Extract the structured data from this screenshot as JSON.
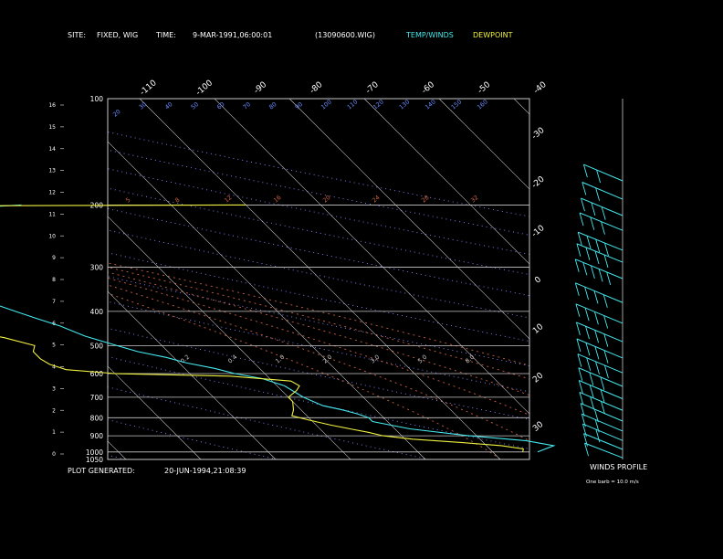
{
  "header": {
    "site_label": "SITE:",
    "site_value": "FIXED, WIG",
    "time_label": "TIME:",
    "time_value": "9-MAR-1991,06:00:01",
    "file_id": "(13090600.WIG)",
    "legend_temp": "TEMP/WINDS",
    "legend_dew": "DEWPOINT"
  },
  "footer": {
    "generated_label": "PLOT GENERATED:",
    "generated_value": "20-JUN-1994,21:08:39"
  },
  "winds_panel": {
    "title": "WINDS PROFILE",
    "note": "One barb = 10.0 m/s"
  },
  "colors": {
    "background": "#000000",
    "frame": "#c8c8c8",
    "temp": "#44e8ee",
    "dew": "#f0f040",
    "text": "#ffffff",
    "mixing_label": "#6b8cff",
    "dry_adiabat": "#8888ff",
    "moist_adiabat": "#c86040"
  },
  "chart_data": {
    "type": "line",
    "skewt": true,
    "pressure_levels": [
      100,
      200,
      300,
      400,
      500,
      600,
      700,
      800,
      900,
      1000,
      1050
    ],
    "pressure_labels": [
      "100",
      "200",
      "300",
      "400",
      "500",
      "600",
      "700",
      "800",
      "900",
      "1000",
      "1050"
    ],
    "ylim_hpa": [
      100,
      1050
    ],
    "height_ticks": [
      "0",
      "1",
      "2",
      "3",
      "4",
      "5",
      "6",
      "7",
      "8",
      "9",
      "10",
      "11",
      "12",
      "13",
      "14",
      "15",
      "16"
    ],
    "top_temp_labels": [
      "-110",
      "-100",
      "-90",
      "-80",
      "-70",
      "-60",
      "-50",
      "-40"
    ],
    "right_temp_labels": [
      "-30",
      "-20",
      "-10",
      "0",
      "10",
      "20",
      "30"
    ],
    "mixing_ratio_labels": [
      "20",
      "30",
      "40",
      "50",
      "60",
      "70",
      "80",
      "90",
      "100",
      "110",
      "120",
      "130",
      "140",
      "150",
      "160"
    ],
    "theta_labels_200": [
      "5",
      "8",
      "12",
      "16",
      "20",
      "24",
      "28",
      "32"
    ],
    "theta_labels_mid": [
      "0.2",
      "0.4",
      "1.0",
      "2.0",
      "3.0",
      "5.0",
      "8.0"
    ],
    "series": [
      {
        "key": "temp",
        "points": [
          [
            1000,
            6.0
          ],
          [
            960,
            9.0
          ],
          [
            930,
            6.0
          ],
          [
            900,
            -1.0
          ],
          [
            860,
            -8.0
          ],
          [
            820,
            -12.0
          ],
          [
            800,
            -12.0
          ],
          [
            780,
            -13.0
          ],
          [
            760,
            -14.5
          ],
          [
            740,
            -16.5
          ],
          [
            700,
            -18.0
          ],
          [
            650,
            -19.0
          ],
          [
            620,
            -21.0
          ],
          [
            600,
            -24.0
          ],
          [
            580,
            -26.0
          ],
          [
            560,
            -29.0
          ],
          [
            540,
            -31.0
          ],
          [
            520,
            -34.0
          ],
          [
            500,
            -36.0
          ],
          [
            470,
            -39.0
          ],
          [
            440,
            -41.0
          ],
          [
            420,
            -43.0
          ],
          [
            400,
            -45.0
          ],
          [
            370,
            -48.0
          ],
          [
            340,
            -51.0
          ],
          [
            310,
            -53.0
          ],
          [
            290,
            -52.0
          ],
          [
            270,
            -50.0
          ],
          [
            250,
            -47.0
          ],
          [
            235,
            -44.0
          ],
          [
            220,
            -42.0
          ],
          [
            205,
            -38.5
          ],
          [
            202,
            -34.0
          ],
          [
            200,
            -30.0
          ]
        ]
      },
      {
        "key": "dew",
        "points": [
          [
            1000,
            4.0
          ],
          [
            980,
            4.5
          ],
          [
            960,
            2.0
          ],
          [
            940,
            -3.0
          ],
          [
            920,
            -9.0
          ],
          [
            900,
            -12.5
          ],
          [
            880,
            -14.0
          ],
          [
            860,
            -16.0
          ],
          [
            840,
            -18.0
          ],
          [
            810,
            -20.5
          ],
          [
            790,
            -22.0
          ],
          [
            760,
            -21.0
          ],
          [
            720,
            -20.0
          ],
          [
            700,
            -20.0
          ],
          [
            670,
            -18.0
          ],
          [
            650,
            -17.0
          ],
          [
            630,
            -17.5
          ],
          [
            610,
            -25.0
          ],
          [
            600,
            -40.0
          ],
          [
            585,
            -46.0
          ],
          [
            565,
            -47.5
          ],
          [
            545,
            -48.0
          ],
          [
            520,
            -48.0
          ],
          [
            500,
            -47.0
          ],
          [
            475,
            -50.0
          ],
          [
            450,
            -55.0
          ],
          [
            420,
            -62.0
          ],
          [
            400,
            -66.0
          ],
          [
            370,
            -71.0
          ],
          [
            340,
            -75.0
          ],
          [
            310,
            -76.0
          ],
          [
            280,
            -78.0
          ],
          [
            260,
            -82.0
          ],
          [
            240,
            -86.0
          ],
          [
            222,
            -87.0
          ],
          [
            212,
            -85.0
          ],
          [
            205,
            -82.0
          ],
          [
            201,
            -40.0
          ],
          [
            200,
            0.0
          ]
        ]
      }
    ],
    "wind_profile": {
      "title": "WINDS PROFILE",
      "unit_note": "One barb = 10.0 m/s",
      "levels": [
        {
          "p": 950,
          "dir": 250,
          "spd": 8
        },
        {
          "p": 900,
          "dir": 260,
          "spd": 12
        },
        {
          "p": 850,
          "dir": 265,
          "spd": 16
        },
        {
          "p": 800,
          "dir": 270,
          "spd": 20
        },
        {
          "p": 750,
          "dir": 272,
          "spd": 24
        },
        {
          "p": 700,
          "dir": 275,
          "spd": 28
        },
        {
          "p": 650,
          "dir": 275,
          "spd": 30
        },
        {
          "p": 600,
          "dir": 278,
          "spd": 32
        },
        {
          "p": 550,
          "dir": 280,
          "spd": 35
        },
        {
          "p": 500,
          "dir": 280,
          "spd": 38
        },
        {
          "p": 450,
          "dir": 282,
          "spd": 40
        },
        {
          "p": 400,
          "dir": 285,
          "spd": 42
        },
        {
          "p": 350,
          "dir": 285,
          "spd": 44
        },
        {
          "p": 300,
          "dir": 288,
          "spd": 45
        },
        {
          "p": 270,
          "dir": 290,
          "spd": 40
        },
        {
          "p": 250,
          "dir": 290,
          "spd": 36
        },
        {
          "p": 220,
          "dir": 288,
          "spd": 30
        },
        {
          "p": 200,
          "dir": 285,
          "spd": 25
        },
        {
          "p": 180,
          "dir": 280,
          "spd": 20
        },
        {
          "p": 160,
          "dir": 278,
          "spd": 15
        }
      ]
    },
    "grid": true
  }
}
